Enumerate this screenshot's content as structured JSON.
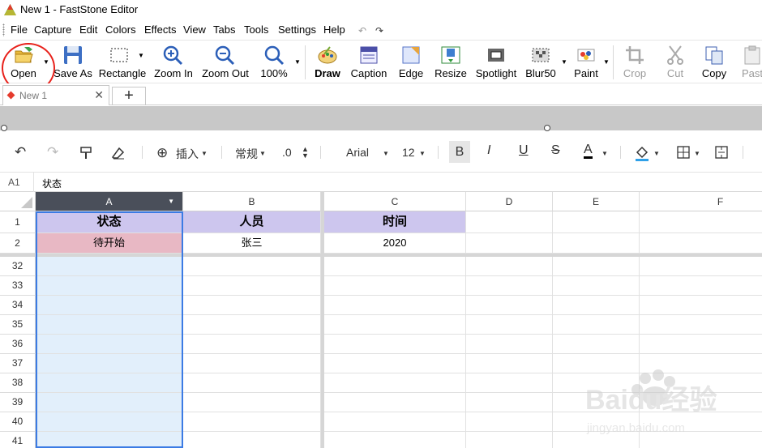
{
  "window": {
    "title": "New 1 - FastStone Editor"
  },
  "menu": {
    "items": [
      "File",
      "Capture",
      "Edit",
      "Colors",
      "Effects",
      "View",
      "Tabs",
      "Tools",
      "Settings",
      "Help"
    ]
  },
  "toolbar": {
    "buttons": [
      {
        "label": "Open",
        "icon": "open-folder-icon"
      },
      {
        "label": "Save As",
        "icon": "floppy-disk-icon"
      },
      {
        "label": "Rectangle",
        "icon": "rectangle-select-icon"
      },
      {
        "label": "Zoom In",
        "icon": "zoom-in-icon"
      },
      {
        "label": "Zoom Out",
        "icon": "zoom-out-icon"
      },
      {
        "label": "100%",
        "icon": "magnifier-icon"
      },
      {
        "label": "Draw",
        "icon": "palette-icon"
      },
      {
        "label": "Caption",
        "icon": "caption-icon"
      },
      {
        "label": "Edge",
        "icon": "edge-icon"
      },
      {
        "label": "Resize",
        "icon": "resize-icon"
      },
      {
        "label": "Spotlight",
        "icon": "spotlight-icon"
      },
      {
        "label": "Blur50",
        "icon": "blur-icon"
      },
      {
        "label": "Paint",
        "icon": "paint-icon"
      },
      {
        "label": "Crop",
        "icon": "crop-icon"
      },
      {
        "label": "Cut",
        "icon": "scissors-icon"
      },
      {
        "label": "Copy",
        "icon": "copy-icon"
      },
      {
        "label": "Past",
        "icon": "paste-icon"
      }
    ]
  },
  "tabs": {
    "active": "New 1",
    "add": "+"
  },
  "sheet_toolbar": {
    "insert": "插入",
    "format": "常规",
    "decimal": ".0",
    "font": "Arial",
    "size": "12",
    "bold": "B",
    "italic": "I",
    "underline": "U",
    "strike": "S",
    "font_color": "A"
  },
  "formula": {
    "ref": "A1",
    "value": "状态"
  },
  "grid": {
    "columns": [
      "A",
      "B",
      "C",
      "D",
      "E",
      "F"
    ],
    "header_row": {
      "num": "1",
      "cells": [
        "状态",
        "人员",
        "时间"
      ]
    },
    "row2": {
      "num": "2",
      "cells": [
        "待开始",
        "张三",
        "2020"
      ]
    },
    "rows": [
      "32",
      "33",
      "34",
      "35",
      "36",
      "37",
      "38",
      "39",
      "40",
      "41"
    ]
  },
  "colors": {
    "header_fill": "#cdc6ee",
    "status_fill": "#e8b8c4",
    "selection": "#3b7be4",
    "selected_col_fill": "#e2effb"
  },
  "watermark": {
    "text": "Baidu经验",
    "sub": "jingyan.baidu.com"
  }
}
